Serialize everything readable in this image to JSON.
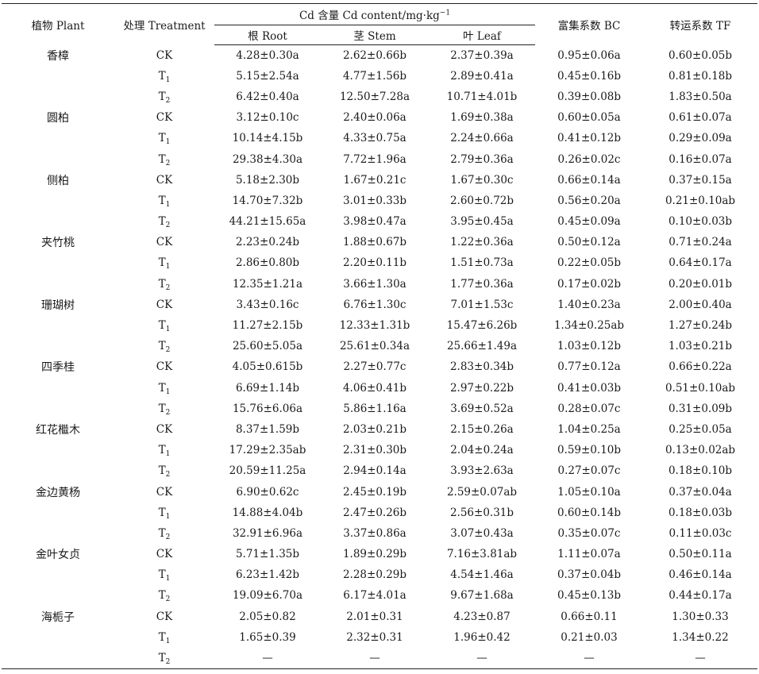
{
  "header": {
    "plant": "植物 Plant",
    "treatment": "处理 Treatment",
    "cd_content_prefix": "Cd 含量 Cd content/mg·kg",
    "cd_content_exp": "−1",
    "root": "根 Root",
    "stem": "茎 Stem",
    "leaf": "叶 Leaf",
    "bc": "富集系数 BC",
    "tf": "转运系数 TF"
  },
  "treatments": {
    "ck": "CK",
    "t": "T",
    "sub1": "1",
    "sub2": "2"
  },
  "rows": [
    {
      "plant": "香樟",
      "trt": "CK",
      "root": "4.28±0.30a",
      "stem": "2.62±0.66b",
      "leaf": "2.37±0.39a",
      "bc": "0.95±0.06a",
      "tf": "0.60±0.05b"
    },
    {
      "plant": "",
      "trt": "T1",
      "root": "5.15±2.54a",
      "stem": "4.77±1.56b",
      "leaf": "2.89±0.41a",
      "bc": "0.45±0.16b",
      "tf": "0.81±0.18b"
    },
    {
      "plant": "",
      "trt": "T2",
      "root": "6.42±0.40a",
      "stem": "12.50±7.28a",
      "leaf": "10.71±4.01b",
      "bc": "0.39±0.08b",
      "tf": "1.83±0.50a"
    },
    {
      "plant": "圆柏",
      "trt": "CK",
      "root": "3.12±0.10c",
      "stem": "2.40±0.06a",
      "leaf": "1.69±0.38a",
      "bc": "0.60±0.05a",
      "tf": "0.61±0.07a"
    },
    {
      "plant": "",
      "trt": "T1",
      "root": "10.14±4.15b",
      "stem": "4.33±0.75a",
      "leaf": "2.24±0.66a",
      "bc": "0.41±0.12b",
      "tf": "0.29±0.09a"
    },
    {
      "plant": "",
      "trt": "T2",
      "root": "29.38±4.30a",
      "stem": "7.72±1.96a",
      "leaf": "2.79±0.36a",
      "bc": "0.26±0.02c",
      "tf": "0.16±0.07a"
    },
    {
      "plant": "侧柏",
      "trt": "CK",
      "root": "5.18±2.30b",
      "stem": "1.67±0.21c",
      "leaf": "1.67±0.30c",
      "bc": "0.66±0.14a",
      "tf": "0.37±0.15a"
    },
    {
      "plant": "",
      "trt": "T1",
      "root": "14.70±7.32b",
      "stem": "3.01±0.33b",
      "leaf": "2.60±0.72b",
      "bc": "0.56±0.20a",
      "tf": "0.21±0.10ab"
    },
    {
      "plant": "",
      "trt": "T2",
      "root": "44.21±15.65a",
      "stem": "3.98±0.47a",
      "leaf": "3.95±0.45a",
      "bc": "0.45±0.09a",
      "tf": "0.10±0.03b"
    },
    {
      "plant": "夹竹桃",
      "trt": "CK",
      "root": "2.23±0.24b",
      "stem": "1.88±0.67b",
      "leaf": "1.22±0.36a",
      "bc": "0.50±0.12a",
      "tf": "0.71±0.24a"
    },
    {
      "plant": "",
      "trt": "T1",
      "root": "2.86±0.80b",
      "stem": "2.20±0.11b",
      "leaf": "1.51±0.73a",
      "bc": "0.22±0.05b",
      "tf": "0.64±0.17a"
    },
    {
      "plant": "",
      "trt": "T2",
      "root": "12.35±1.21a",
      "stem": "3.66±1.30a",
      "leaf": "1.77±0.36a",
      "bc": "0.17±0.02b",
      "tf": "0.20±0.01b"
    },
    {
      "plant": "珊瑚树",
      "trt": "CK",
      "root": "3.43±0.16c",
      "stem": "6.76±1.30c",
      "leaf": "7.01±1.53c",
      "bc": "1.40±0.23a",
      "tf": "2.00±0.40a"
    },
    {
      "plant": "",
      "trt": "T1",
      "root": "11.27±2.15b",
      "stem": "12.33±1.31b",
      "leaf": "15.47±6.26b",
      "bc": "1.34±0.25ab",
      "tf": "1.27±0.24b"
    },
    {
      "plant": "",
      "trt": "T2",
      "root": "25.60±5.05a",
      "stem": "25.61±0.34a",
      "leaf": "25.66±1.49a",
      "bc": "1.03±0.12b",
      "tf": "1.03±0.21b"
    },
    {
      "plant": "四季桂",
      "trt": "CK",
      "root": "4.05±0.615b",
      "stem": "2.27±0.77c",
      "leaf": "2.83±0.34b",
      "bc": "0.77±0.12a",
      "tf": "0.66±0.22a"
    },
    {
      "plant": "",
      "trt": "T1",
      "root": "6.69±1.14b",
      "stem": "4.06±0.41b",
      "leaf": "2.97±0.22b",
      "bc": "0.41±0.03b",
      "tf": "0.51±0.10ab"
    },
    {
      "plant": "",
      "trt": "T2",
      "root": "15.76±6.06a",
      "stem": "5.86±1.16a",
      "leaf": "3.69±0.52a",
      "bc": "0.28±0.07c",
      "tf": "0.31±0.09b"
    },
    {
      "plant": "红花檵木",
      "trt": "CK",
      "root": "8.37±1.59b",
      "stem": "2.03±0.21b",
      "leaf": "2.15±0.26a",
      "bc": "1.04±0.25a",
      "tf": "0.25±0.05a"
    },
    {
      "plant": "",
      "trt": "T1",
      "root": "17.29±2.35ab",
      "stem": "2.31±0.30b",
      "leaf": "2.04±0.24a",
      "bc": "0.59±0.10b",
      "tf": "0.13±0.02ab"
    },
    {
      "plant": "",
      "trt": "T2",
      "root": "20.59±11.25a",
      "stem": "2.94±0.14a",
      "leaf": "3.93±2.63a",
      "bc": "0.27±0.07c",
      "tf": "0.18±0.10b"
    },
    {
      "plant": "金边黄杨",
      "trt": "CK",
      "root": "6.90±0.62c",
      "stem": "2.45±0.19b",
      "leaf": "2.59±0.07ab",
      "bc": "1.05±0.10a",
      "tf": "0.37±0.04a"
    },
    {
      "plant": "",
      "trt": "T1",
      "root": "14.88±4.04b",
      "stem": "2.47±0.26b",
      "leaf": "2.56±0.31b",
      "bc": "0.60±0.14b",
      "tf": "0.18±0.03b"
    },
    {
      "plant": "",
      "trt": "T2",
      "root": "32.91±6.96a",
      "stem": "3.37±0.86a",
      "leaf": "3.07±0.43a",
      "bc": "0.35±0.07c",
      "tf": "0.11±0.03c"
    },
    {
      "plant": "金叶女贞",
      "trt": "CK",
      "root": "5.71±1.35b",
      "stem": "1.89±0.29b",
      "leaf": "7.16±3.81ab",
      "bc": "1.11±0.07a",
      "tf": "0.50±0.11a"
    },
    {
      "plant": "",
      "trt": "T1",
      "root": "6.23±1.42b",
      "stem": "2.28±0.29b",
      "leaf": "4.54±1.46a",
      "bc": "0.37±0.04b",
      "tf": "0.46±0.14a"
    },
    {
      "plant": "",
      "trt": "T2",
      "root": "19.09±6.70a",
      "stem": "6.17±4.01a",
      "leaf": "9.67±1.68a",
      "bc": "0.45±0.13b",
      "tf": "0.44±0.17a"
    },
    {
      "plant": "海栀子",
      "trt": "CK",
      "root": "2.05±0.82",
      "stem": "2.01±0.31",
      "leaf": "4.23±0.87",
      "bc": "0.66±0.11",
      "tf": "1.30±0.33"
    },
    {
      "plant": "",
      "trt": "T1",
      "root": "1.65±0.39",
      "stem": "2.32±0.31",
      "leaf": "1.96±0.42",
      "bc": "0.21±0.03",
      "tf": "1.34±0.22"
    },
    {
      "plant": "",
      "trt": "T2",
      "root": "—",
      "stem": "—",
      "leaf": "—",
      "bc": "—",
      "tf": "—"
    }
  ]
}
